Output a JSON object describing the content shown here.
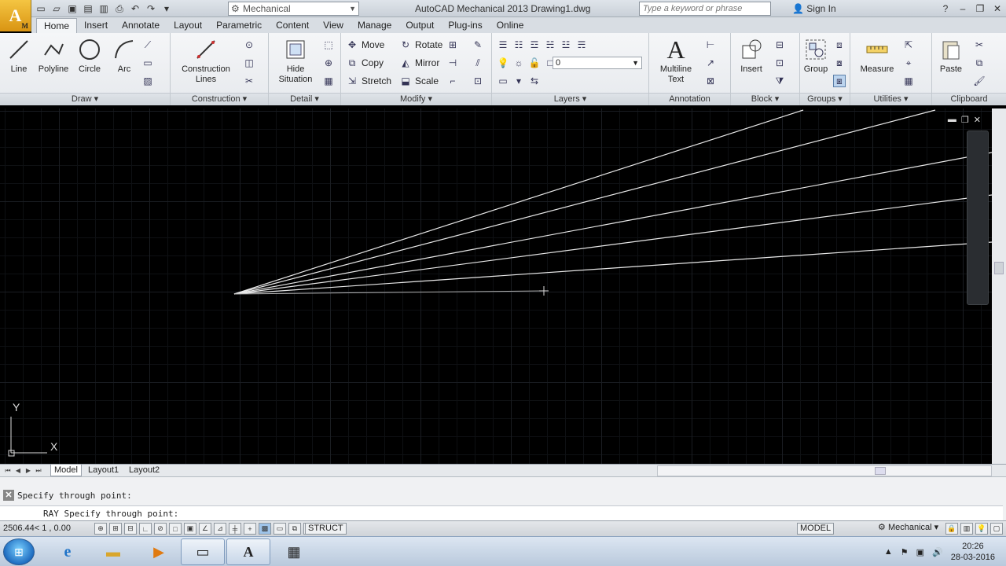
{
  "app": {
    "logo_letter": "A",
    "logo_sub": "M",
    "title": "AutoCAD Mechanical 2013    Drawing1.dwg",
    "workspace": "Mechanical",
    "search_placeholder": "Type a keyword or phrase",
    "sign_in": "Sign In"
  },
  "tabs": [
    "Home",
    "Insert",
    "Annotate",
    "Layout",
    "Parametric",
    "Content",
    "View",
    "Manage",
    "Output",
    "Plug-ins",
    "Online"
  ],
  "ribbon": {
    "draw": {
      "title": "Draw",
      "line": "Line",
      "polyline": "Polyline",
      "circle": "Circle",
      "arc": "Arc"
    },
    "construction": {
      "title": "Construction",
      "label1": "Construction",
      "label2": "Lines"
    },
    "detail": {
      "title": "Detail",
      "label1": "Hide",
      "label2": "Situation"
    },
    "modify": {
      "title": "Modify",
      "move": "Move",
      "copy": "Copy",
      "stretch": "Stretch",
      "rotate": "Rotate",
      "mirror": "Mirror",
      "scale": "Scale"
    },
    "layers": {
      "title": "Layers",
      "current": "0"
    },
    "annotation": {
      "title": "Annotation",
      "label1": "Multiline",
      "label2": "Text"
    },
    "block": {
      "title": "Block",
      "insert": "Insert"
    },
    "groups": {
      "title": "Groups",
      "group": "Group"
    },
    "utilities": {
      "title": "Utilities",
      "measure": "Measure"
    },
    "clipboard": {
      "title": "Clipboard",
      "paste": "Paste"
    }
  },
  "canvas": {
    "ucs_x": "X",
    "ucs_y": "Y"
  },
  "layout_tabs": [
    "Model",
    "Layout1",
    "Layout2"
  ],
  "command": {
    "history": "Specify through point:",
    "input": "RAY Specify through point:"
  },
  "status": {
    "coords": "2506.44< 1     , 0.00",
    "struct": "STRUCT",
    "model": "MODEL",
    "workspace": "Mechanical"
  },
  "taskbar": {
    "time": "20:26",
    "date": "28-03-2016"
  }
}
